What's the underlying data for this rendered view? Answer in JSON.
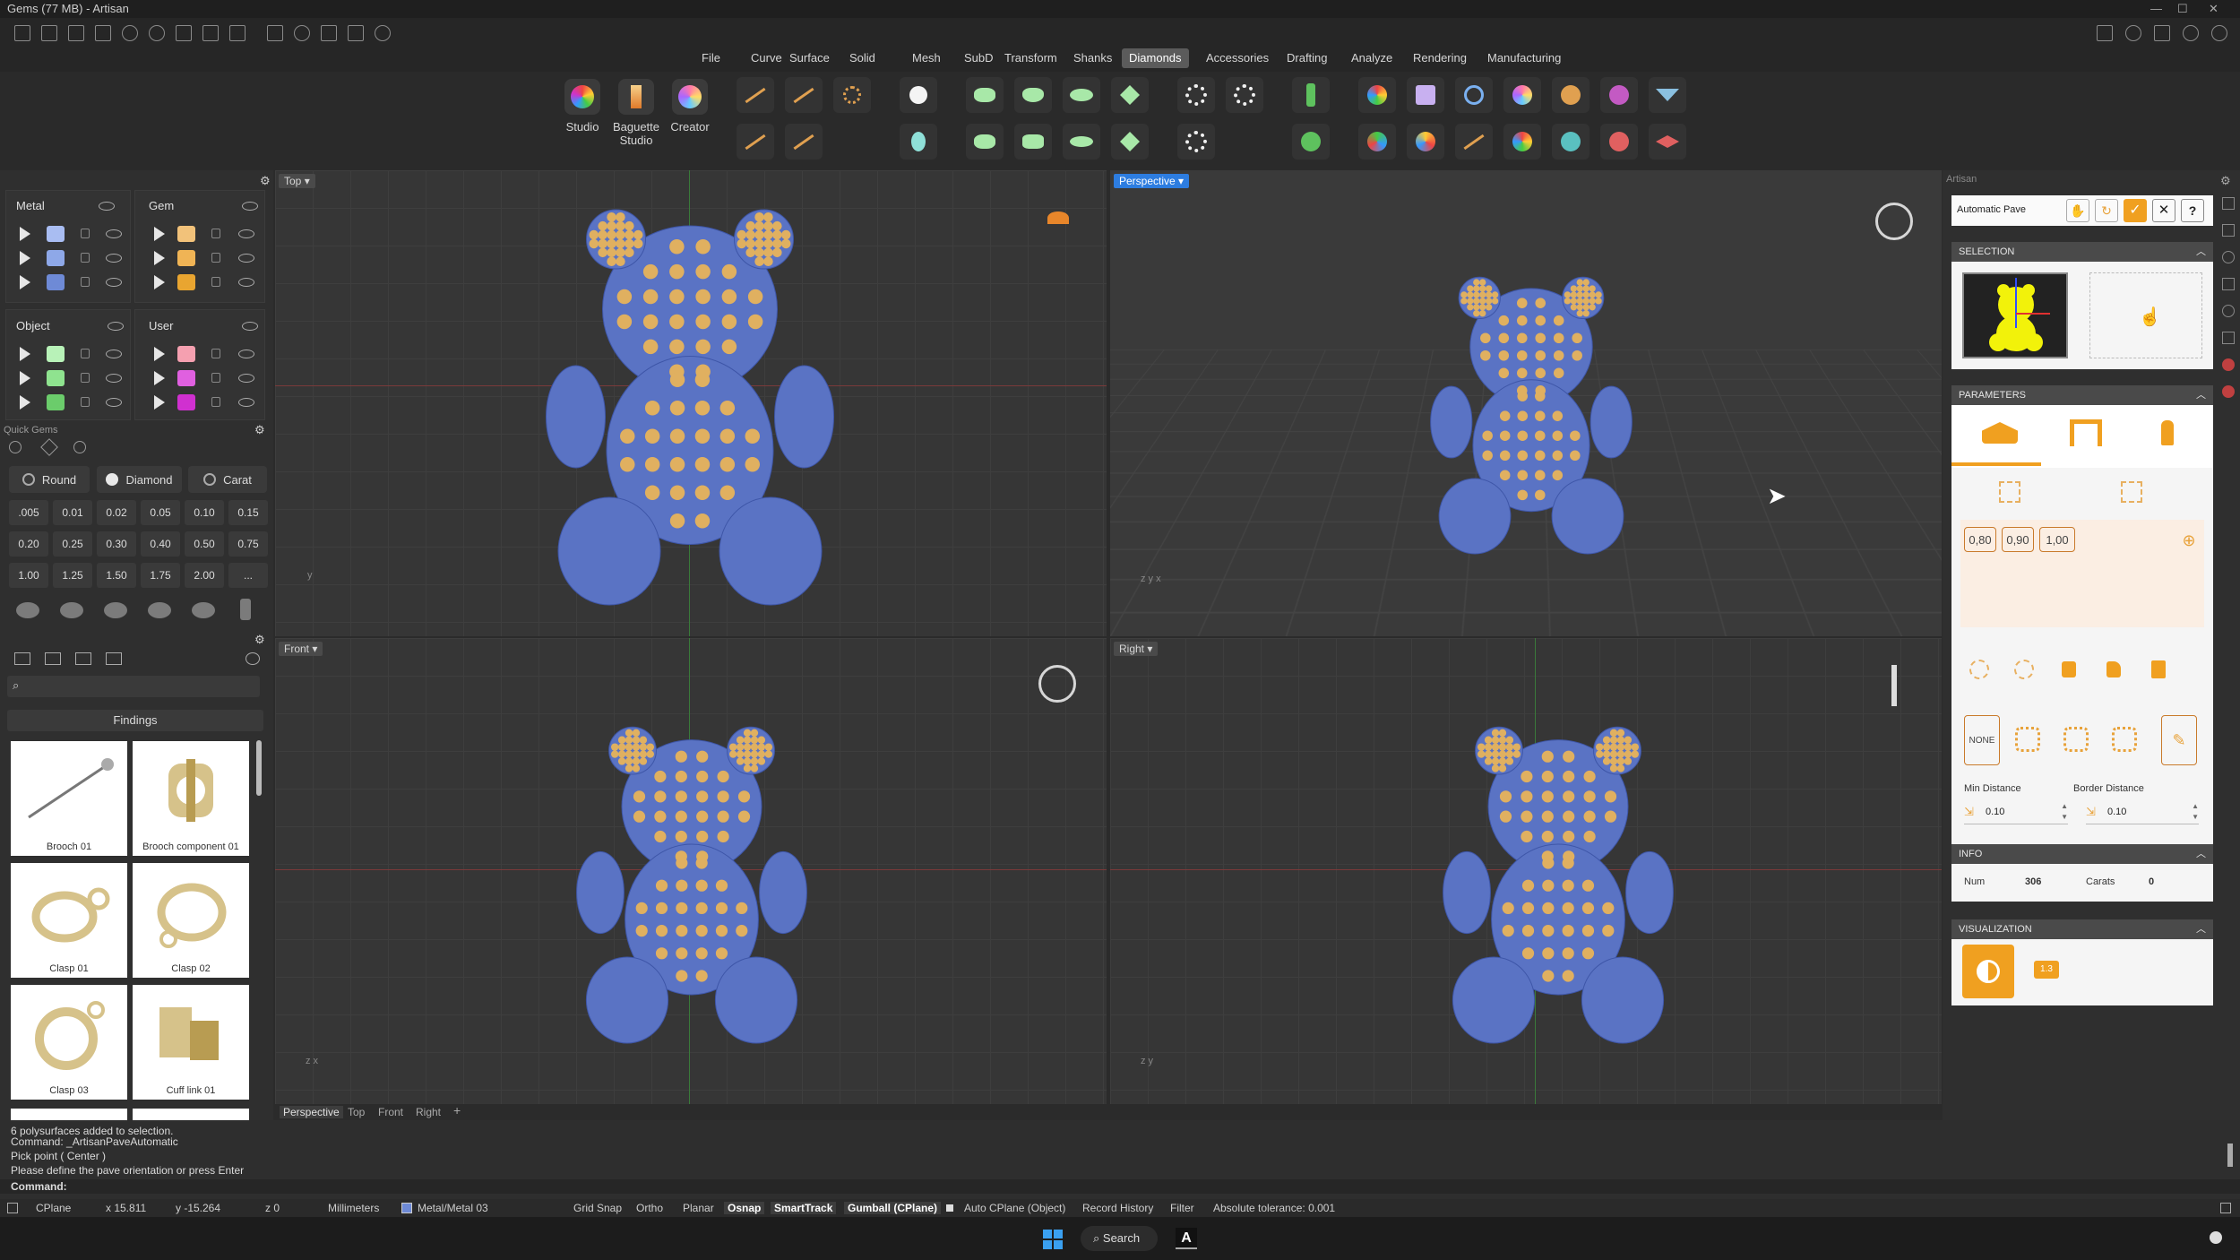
{
  "window": {
    "title": "Gems (77 MB) - Artisan"
  },
  "menu": [
    "File",
    "Curve",
    "Surface",
    "Solid",
    "Mesh",
    "SubD",
    "Transform",
    "Shanks",
    "Diamonds",
    "Accessories",
    "Drafting",
    "Analyze",
    "Rendering",
    "Manufacturing"
  ],
  "menu_active": "Diamonds",
  "ribbon": {
    "studio": "Studio",
    "baguette_studio_1": "Baguette",
    "baguette_studio_2": "Studio",
    "creator": "Creator"
  },
  "layers": {
    "metal": "Metal",
    "gem": "Gem",
    "object": "Object",
    "user": "User",
    "metal_colors": [
      "#a9bdf2",
      "#8ea8e8",
      "#6e8ad6"
    ],
    "gem_colors": [
      "#f2c27a",
      "#f0b455",
      "#e9a530"
    ],
    "object_colors": [
      "#b8f2b8",
      "#8fe38f",
      "#6bcc6b"
    ],
    "user_colors": [
      "#f5a0b0",
      "#e060e0",
      "#d030d0"
    ]
  },
  "quick_gems": {
    "title": "Quick Gems",
    "round": "Round",
    "diamond": "Diamond",
    "carat": "Carat",
    "sizes": [
      ".005",
      "0.01",
      "0.02",
      "0.05",
      "0.10",
      "0.15",
      "0.20",
      "0.25",
      "0.30",
      "0.40",
      "0.50",
      "0.75",
      "1.00",
      "1.25",
      "1.50",
      "1.75",
      "2.00",
      "..."
    ]
  },
  "library": {
    "category": "Findings",
    "items": [
      "Brooch 01",
      "Brooch component 01",
      "Clasp 01",
      "Clasp 02",
      "Clasp 03",
      "Cuff link 01"
    ]
  },
  "viewports": {
    "top": "Top",
    "perspective": "Perspective",
    "front": "Front",
    "right": "Right"
  },
  "view_tabs": [
    "Perspective",
    "Top",
    "Front",
    "Right"
  ],
  "artisan": {
    "panel_title": "Artisan",
    "command": "Automatic Pave",
    "selection": "SELECTION",
    "parameters": "PARAMETERS",
    "ratios": [
      "0,80",
      "0,90",
      "1,00"
    ],
    "none": "NONE",
    "min_distance_label": "Min Distance",
    "border_distance_label": "Border Distance",
    "min_distance": "0.10",
    "border_distance": "0.10",
    "info": "INFO",
    "num_label": "Num",
    "num": "306",
    "carats_label": "Carats",
    "carats": "0",
    "visualization": "VISUALIZATION",
    "vis_badge": "1.3"
  },
  "command_history": [
    "6 polysurfaces added to selection.",
    "Command: _ArtisanPaveAutomatic",
    "Pick point ( Center )",
    "Please define the pave orientation or press Enter"
  ],
  "command_prompt": "Command:",
  "status": {
    "cplane": "CPlane",
    "x": "x 15.811",
    "y": "y -15.264",
    "z": "z 0",
    "units": "Millimeters",
    "layer": "Metal/Metal 03",
    "grid_snap": "Grid Snap",
    "ortho": "Ortho",
    "planar": "Planar",
    "osnap": "Osnap",
    "smarttrack": "SmartTrack",
    "gumball": "Gumball (CPlane)",
    "auto_cplane": "Auto CPlane (Object)",
    "record_history": "Record History",
    "filter": "Filter",
    "tolerance": "Absolute tolerance: 0.001"
  },
  "taskbar": {
    "search": "Search"
  },
  "colors": {
    "accent": "#e8a23a",
    "body": "#5a73c4",
    "gem": "#e0b060",
    "viewport_active": "#2d7de0"
  }
}
